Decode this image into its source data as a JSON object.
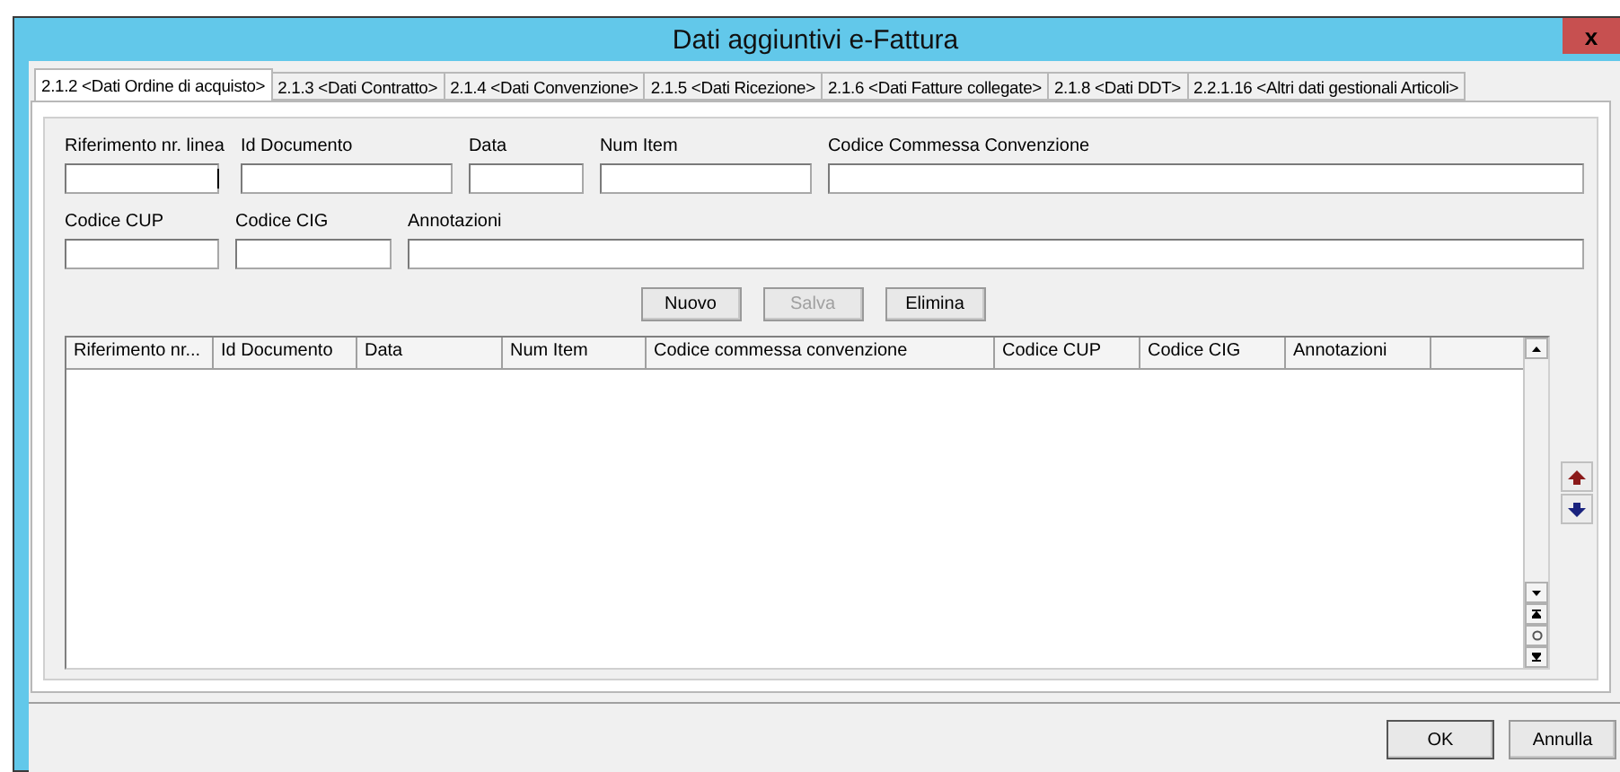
{
  "window": {
    "title": "Dati aggiuntivi e-Fattura",
    "close": "x"
  },
  "tabs": [
    {
      "label": "2.1.2 <Dati Ordine di acquisto>",
      "selected": true
    },
    {
      "label": "2.1.3 <Dati Contratto>",
      "selected": false
    },
    {
      "label": "2.1.4 <Dati Convenzione>",
      "selected": false
    },
    {
      "label": "2.1.5 <Dati Ricezione>",
      "selected": false
    },
    {
      "label": "2.1.6 <Dati Fatture collegate>",
      "selected": false
    },
    {
      "label": "2.1.8 <Dati DDT>",
      "selected": false
    },
    {
      "label": "2.2.1.16 <Altri dati gestionali Articoli>",
      "selected": false
    }
  ],
  "form_rows": [
    [
      {
        "label": "Riferimento nr. linea",
        "focused": true
      },
      {
        "label": "Id Documento",
        "focused": false
      },
      {
        "label": "Data",
        "focused": false
      },
      {
        "label": "Num Item",
        "focused": false
      },
      {
        "label": "Codice Commessa Convenzione",
        "focused": false
      }
    ],
    [
      {
        "label": "Codice CUP",
        "focused": false
      },
      {
        "label": "Codice CIG",
        "focused": false
      },
      {
        "label": "Annotazioni",
        "focused": false
      }
    ]
  ],
  "actions": [
    {
      "label": "Nuovo",
      "disabled": false
    },
    {
      "label": "Salva",
      "disabled": true
    },
    {
      "label": "Elimina",
      "disabled": false
    }
  ],
  "table": {
    "columns": [
      "Riferimento nr...",
      "Id Documento",
      "Data",
      "Num Item",
      "Codice commessa convenzione",
      "Codice CUP",
      "Codice CIG",
      "Annotazioni"
    ]
  },
  "footer_buttons": [
    {
      "label": "OK",
      "default": true
    },
    {
      "label": "Annulla",
      "default": false
    }
  ]
}
